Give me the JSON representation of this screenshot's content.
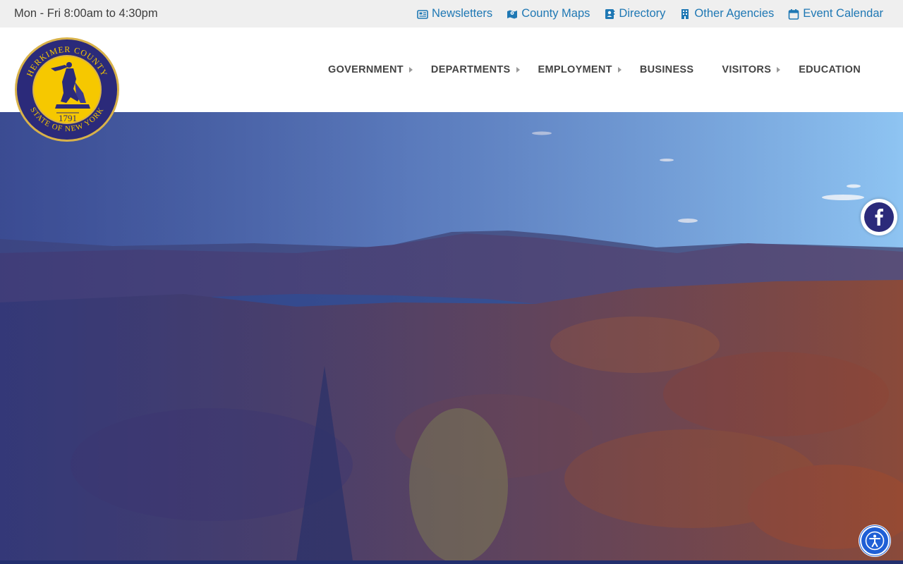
{
  "topbar": {
    "hours": "Mon - Fri 8:00am to 4:30pm",
    "links": [
      {
        "label": "Newsletters",
        "icon": "newspaper-icon"
      },
      {
        "label": "County Maps",
        "icon": "map-icon"
      },
      {
        "label": "Directory",
        "icon": "address-book-icon"
      },
      {
        "label": "Other Agencies",
        "icon": "building-icon"
      },
      {
        "label": "Event Calendar",
        "icon": "calendar-icon"
      }
    ],
    "link_color": "#1f78b4"
  },
  "seal": {
    "top_text": "HERKIMER COUNTY",
    "bottom_text": "STATE OF NEW YORK",
    "year": "1791",
    "colors": {
      "ring": "#2b2a7a",
      "fill": "#f6c800"
    }
  },
  "nav": {
    "items": [
      {
        "label": "GOVERNMENT",
        "has_submenu": true
      },
      {
        "label": "DEPARTMENTS",
        "has_submenu": true
      },
      {
        "label": "EMPLOYMENT",
        "has_submenu": true
      },
      {
        "label": "BUSINESS",
        "has_submenu": false
      },
      {
        "label": "VISITORS",
        "has_submenu": true
      },
      {
        "label": "EDUCATION",
        "has_submenu": false
      }
    ]
  },
  "social": {
    "icon": "facebook-icon"
  },
  "accessibility": {
    "icon": "accessibility-icon"
  }
}
